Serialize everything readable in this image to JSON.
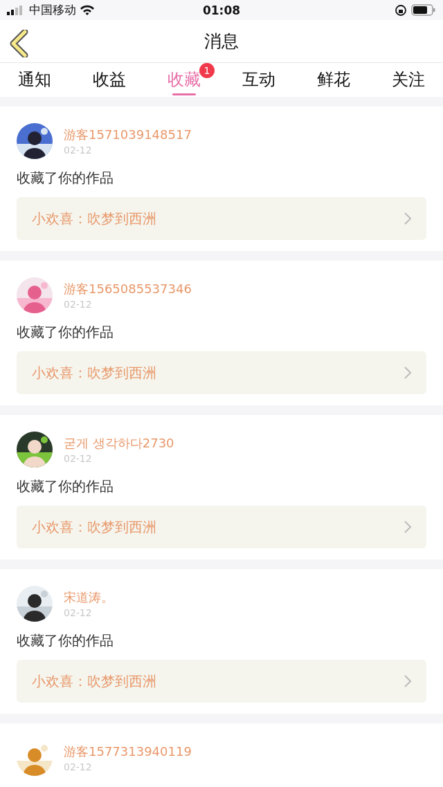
{
  "status_bar": {
    "carrier": "中国移动",
    "time": "01:08"
  },
  "header": {
    "title": "消息"
  },
  "tabs": [
    {
      "label": "通知",
      "selected": false
    },
    {
      "label": "收益",
      "selected": false
    },
    {
      "label": "收藏",
      "selected": true,
      "badge": "1"
    },
    {
      "label": "互动",
      "selected": false
    },
    {
      "label": "鲜花",
      "selected": false
    },
    {
      "label": "关注",
      "selected": false
    }
  ],
  "messages": [
    {
      "user": "游客1571039148517",
      "date": "02-12",
      "action": "收藏了你的作品",
      "work": "小欢喜：吹梦到西洲"
    },
    {
      "user": "游客1565085537346",
      "date": "02-12",
      "action": "收藏了你的作品",
      "work": "小欢喜：吹梦到西洲"
    },
    {
      "user": "굳게 생각하다2730",
      "date": "02-12",
      "action": "收藏了你的作品",
      "work": "小欢喜：吹梦到西洲"
    },
    {
      "user": "宋道涛。",
      "date": "02-12",
      "action": "收藏了你的作品",
      "work": "小欢喜：吹梦到西洲"
    },
    {
      "user": "游客1577313940119",
      "date": "02-12"
    }
  ]
}
